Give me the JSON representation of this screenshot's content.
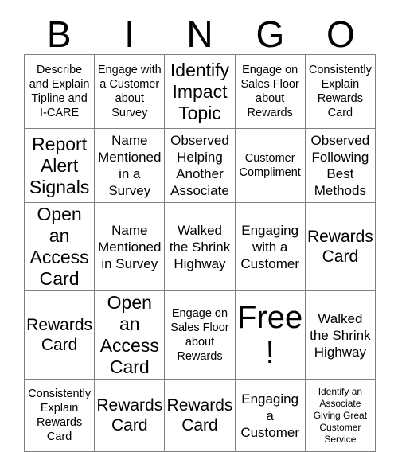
{
  "card": {
    "header_letters": [
      "B",
      "I",
      "N",
      "G",
      "O"
    ],
    "columns": 5,
    "rows": 5,
    "grid_border_color": "#808080",
    "text_color": "#000000",
    "background_color": "#ffffff",
    "cells": [
      [
        {
          "text": "Describe and Explain Tipline and I-CARE",
          "size": "fs-sm"
        },
        {
          "text": "Engage with a Customer about Survey",
          "size": "fs-sm"
        },
        {
          "text": "Identify Impact Topic",
          "size": "fs-xl"
        },
        {
          "text": "Engage on Sales Floor about Rewards",
          "size": "fs-sm"
        },
        {
          "text": "Consistently Explain Rewards Card",
          "size": "fs-sm"
        }
      ],
      [
        {
          "text": "Report Alert Signals",
          "size": "fs-xl"
        },
        {
          "text": "Name Mentioned in a Survey",
          "size": "fs-md"
        },
        {
          "text": "Observed Helping Another Associate",
          "size": "fs-md"
        },
        {
          "text": "Customer Compliment",
          "size": "fs-sm"
        },
        {
          "text": "Observed Following Best Methods",
          "size": "fs-md"
        }
      ],
      [
        {
          "text": "Open an Access Card",
          "size": "fs-xl"
        },
        {
          "text": "Name Mentioned in Survey",
          "size": "fs-md"
        },
        {
          "text": "Walked the Shrink Highway",
          "size": "fs-md"
        },
        {
          "text": "Engaging with a Customer",
          "size": "fs-md"
        },
        {
          "text": "Rewards Card",
          "size": "fs-lg"
        }
      ],
      [
        {
          "text": "Rewards Card",
          "size": "fs-lg"
        },
        {
          "text": "Open an Access Card",
          "size": "fs-xl"
        },
        {
          "text": "Engage on Sales Floor about Rewards",
          "size": "fs-sm"
        },
        {
          "text": "Free!",
          "size": "fs-free"
        },
        {
          "text": "Walked the Shrink Highway",
          "size": "fs-md"
        }
      ],
      [
        {
          "text": "Consistently Explain Rewards Card",
          "size": "fs-sm"
        },
        {
          "text": "Rewards Card",
          "size": "fs-lg"
        },
        {
          "text": "Rewards Card",
          "size": "fs-lg"
        },
        {
          "text": "Engaging a Customer",
          "size": "fs-md"
        },
        {
          "text": "Identify an Associate Giving Great Customer Service",
          "size": "fs-xs"
        }
      ]
    ]
  }
}
